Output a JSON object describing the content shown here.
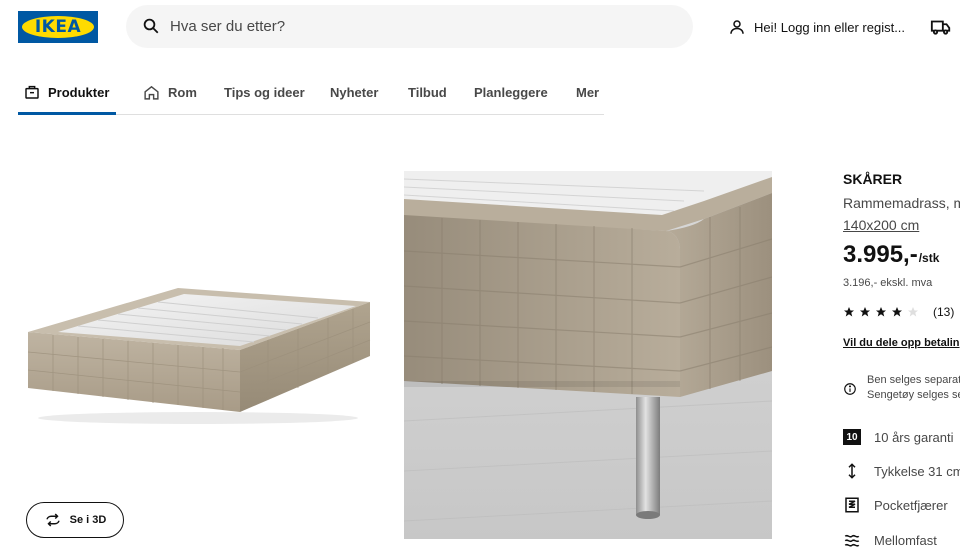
{
  "header": {
    "logo_text": "IKEA",
    "search_placeholder": "Hva ser du etter?",
    "login_label": "Hei! Logg inn eller regist..."
  },
  "nav": {
    "items": [
      {
        "label": "Produkter",
        "icon": "catalog-icon",
        "active": true
      },
      {
        "label": "Rom",
        "icon": "home-icon",
        "active": false
      },
      {
        "label": "Tips og ideer",
        "active": false
      },
      {
        "label": "Nyheter",
        "active": false
      },
      {
        "label": "Tilbud",
        "active": false
      },
      {
        "label": "Planleggere",
        "active": false
      },
      {
        "label": "Mer",
        "active": false
      }
    ]
  },
  "gallery": {
    "view_3d_label": "Se i 3D"
  },
  "product": {
    "name": "SKÅRER",
    "description": "Rammemadrass, m",
    "size": "140x200 cm",
    "price": "3.995,-",
    "price_unit": "/stk",
    "price_excl": "3.196,- ekskl. mva",
    "rating_stars": 4,
    "rating_max": 5,
    "rating_count": "(13)",
    "split_payment": "Vil du dele opp betalin",
    "notice_line1": "Ben selges separat",
    "notice_line2": "Sengetøy selges se",
    "features": [
      {
        "icon": "ten-years-badge-icon",
        "badge": "10",
        "label": "10 års garanti"
      },
      {
        "icon": "thickness-arrow-icon",
        "label": "Tykkelse 31 cm"
      },
      {
        "icon": "spring-icon",
        "label": "Pocketfjærer"
      },
      {
        "icon": "firmness-waves-icon",
        "label": "Mellomfast"
      }
    ]
  },
  "colors": {
    "brand_blue": "#0058a3",
    "brand_yellow": "#ffdb00",
    "mattress_beige": "#b1a592"
  }
}
